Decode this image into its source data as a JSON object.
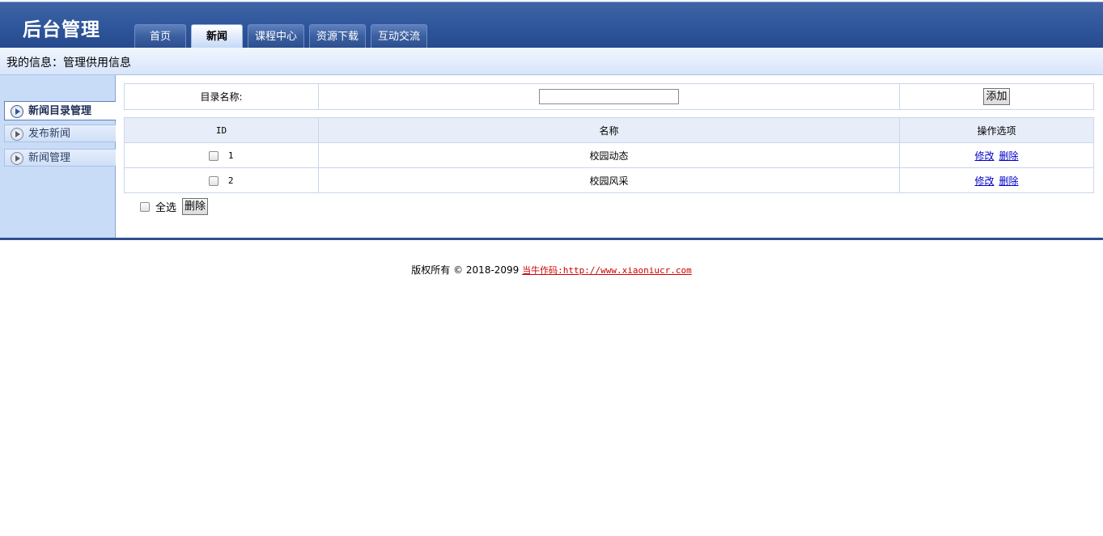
{
  "header": {
    "logo": "后台管理",
    "tabs": [
      "首页",
      "新闻",
      "课程中心",
      "资源下载",
      "互动交流"
    ],
    "active_tab": "新闻"
  },
  "infobar": {
    "text": "我的信息：管理供用信息"
  },
  "sidebar": {
    "items": [
      "新闻目录管理",
      "发布新闻",
      "新闻管理"
    ],
    "active": "新闻目录管理"
  },
  "add_form": {
    "label": "目录名称:",
    "input_value": "",
    "button": "添加"
  },
  "table": {
    "headers": [
      "ID",
      "名称",
      "操作选项"
    ],
    "rows": [
      {
        "id": "1",
        "name": "校园动态",
        "edit": "修改",
        "delete": "删除"
      },
      {
        "id": "2",
        "name": "校园风采",
        "edit": "修改",
        "delete": "删除"
      }
    ]
  },
  "bulk": {
    "select_all": "全选",
    "delete_button": "删除"
  },
  "footer": {
    "text": "版权所有 © 2018-2099 ",
    "link": "当牛作码:http://www.xiaoniucr.com"
  },
  "colors": {
    "header": "#2f559b",
    "sidebar": "#c9dcf7",
    "link": "#0000cc",
    "footer_link": "#cc0000"
  }
}
